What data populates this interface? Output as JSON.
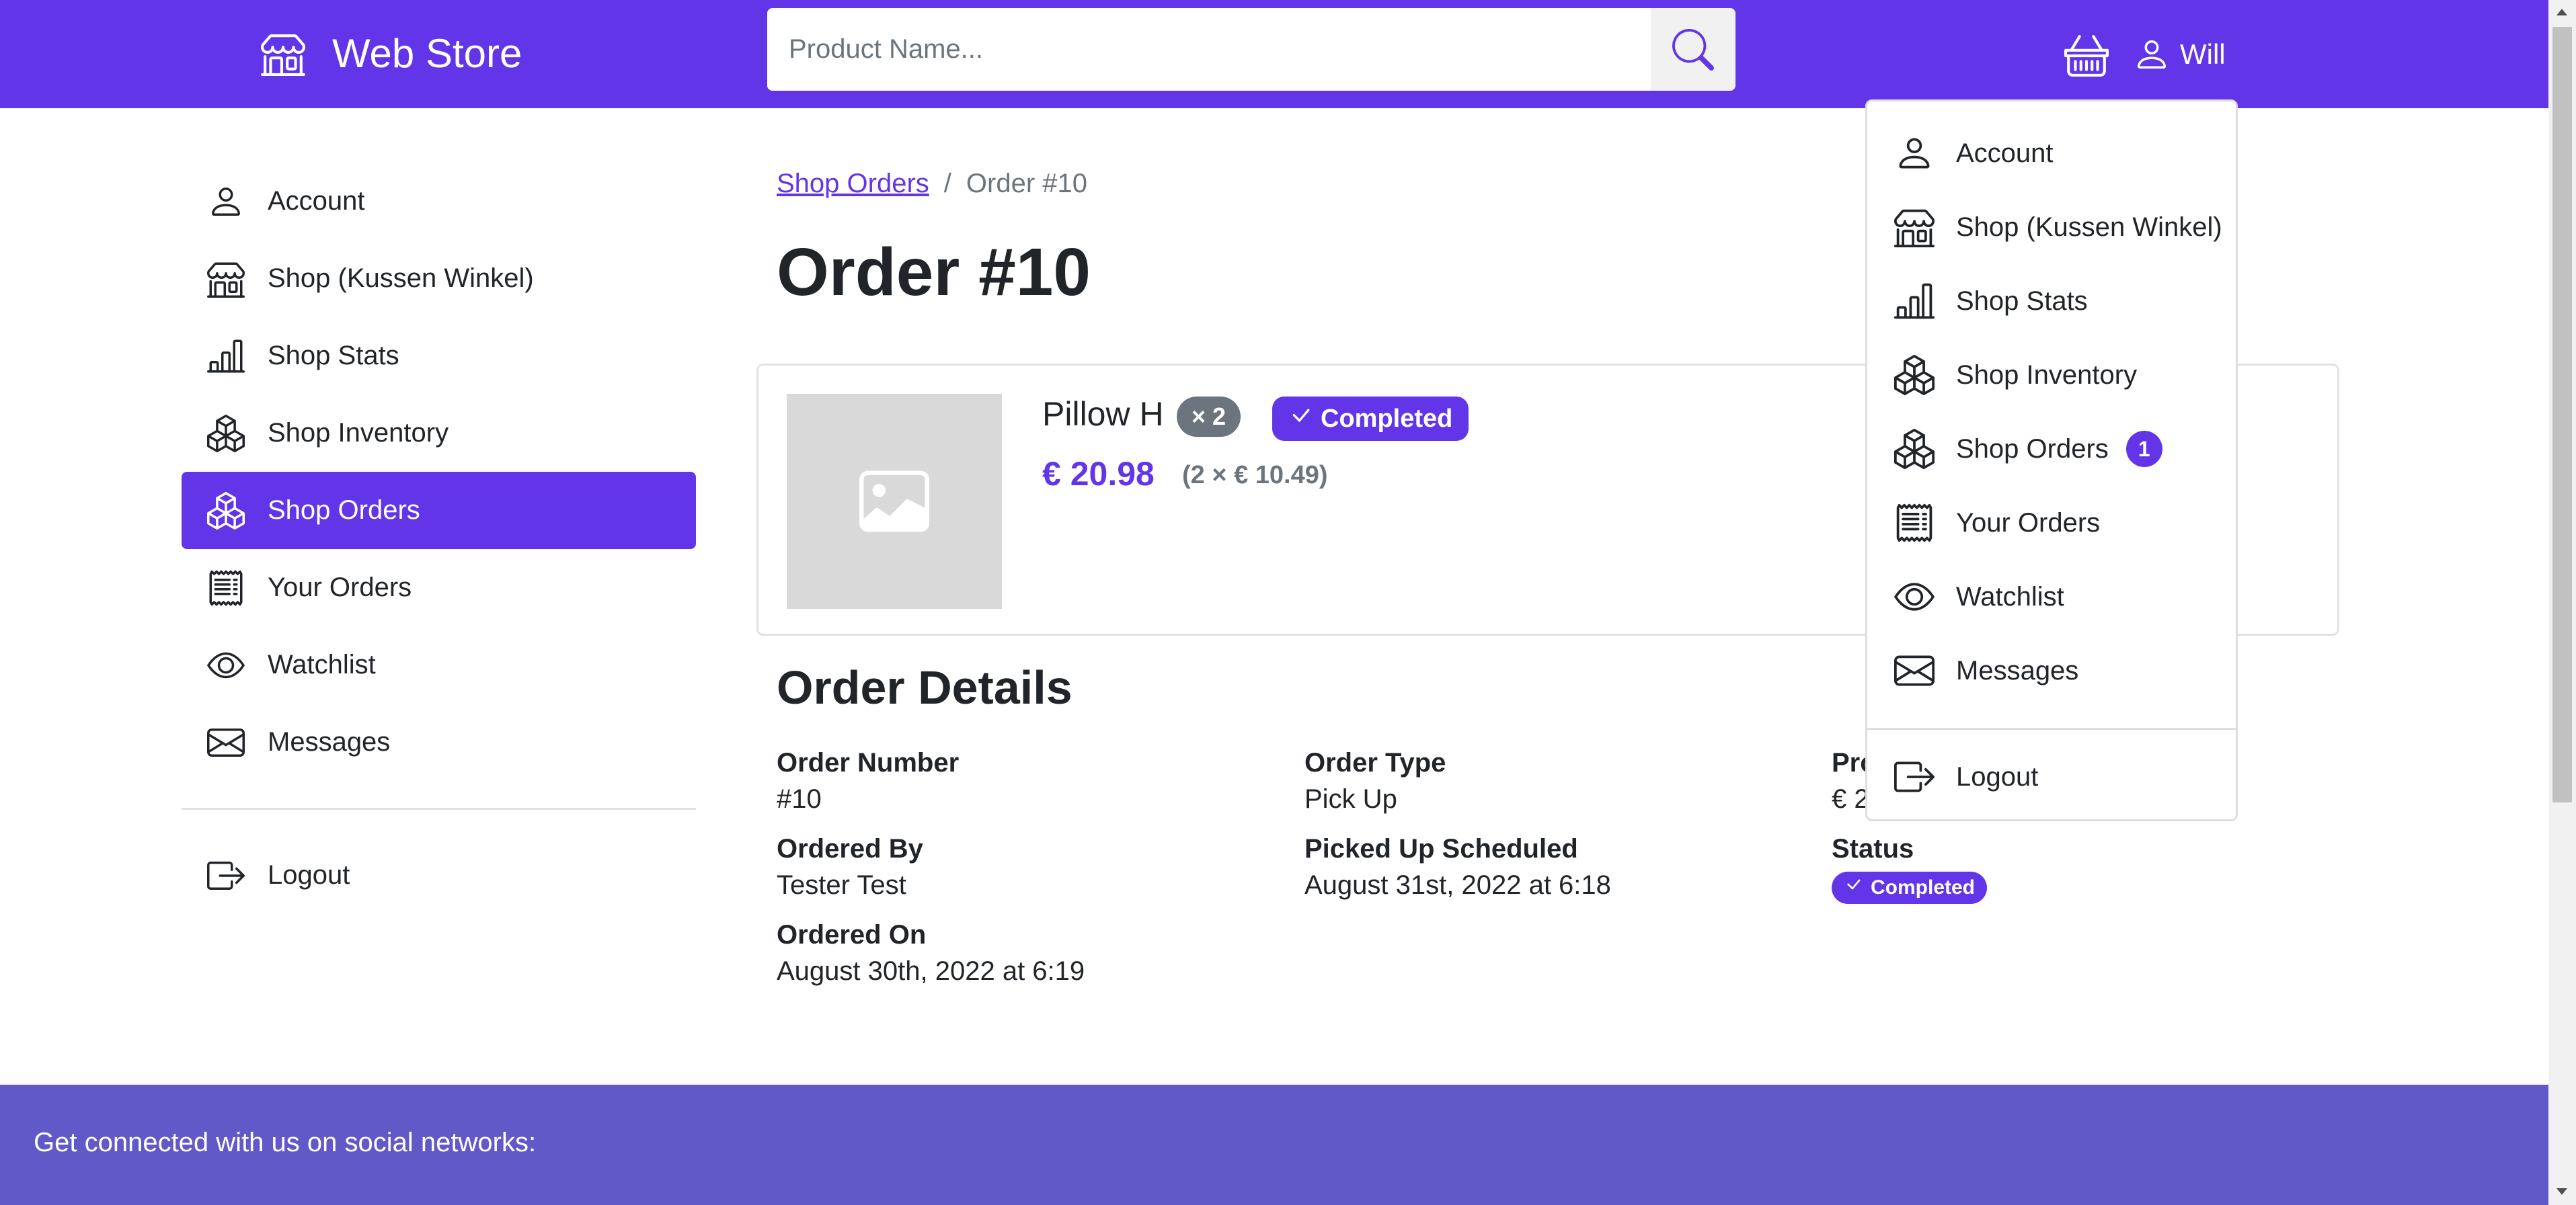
{
  "navbar": {
    "brand": "Web Store",
    "search_placeholder": "Product Name...",
    "user_name": "Will"
  },
  "sidebar": {
    "items": [
      {
        "label": "Account",
        "icon": "person-icon"
      },
      {
        "label": "Shop (Kussen Winkel)",
        "icon": "shop-icon"
      },
      {
        "label": "Shop Stats",
        "icon": "bar-chart-icon"
      },
      {
        "label": "Shop Inventory",
        "icon": "boxes-icon"
      },
      {
        "label": "Shop Orders",
        "icon": "boxes-icon",
        "active": true
      },
      {
        "label": "Your Orders",
        "icon": "receipt-icon"
      },
      {
        "label": "Watchlist",
        "icon": "eye-icon"
      },
      {
        "label": "Messages",
        "icon": "envelope-icon"
      }
    ],
    "logout": "Logout"
  },
  "breadcrumb": {
    "parent": "Shop Orders",
    "separator": "/",
    "current": "Order #10"
  },
  "page_title": "Order #10",
  "product": {
    "name": "Pillow H",
    "quantity": "× 2",
    "status": "Completed",
    "total": "€ 20.98",
    "unit": "(2 × € 10.49)"
  },
  "details": {
    "title": "Order Details",
    "order_number_label": "Order Number",
    "order_number": "#10",
    "ordered_by_label": "Ordered By",
    "ordered_by": "Tester Test",
    "ordered_on_label": "Ordered On",
    "ordered_on": "August 30th, 2022 at 6:19",
    "order_type_label": "Order Type",
    "order_type": "Pick Up",
    "picked_up_label": "Picked Up Scheduled",
    "picked_up": "August 31st, 2022 at 6:18",
    "price_label_partial": "Pro",
    "price_partial": "€ 2",
    "status_label": "Status",
    "status": "Completed"
  },
  "dropdown": {
    "items": [
      {
        "label": "Account",
        "icon": "person-icon"
      },
      {
        "label": "Shop (Kussen Winkel)",
        "icon": "shop-icon"
      },
      {
        "label": "Shop Stats",
        "icon": "bar-chart-icon"
      },
      {
        "label": "Shop Inventory",
        "icon": "boxes-icon"
      },
      {
        "label": "Shop Orders",
        "icon": "boxes-icon",
        "badge": "1"
      },
      {
        "label": "Your Orders",
        "icon": "receipt-icon"
      },
      {
        "label": "Watchlist",
        "icon": "eye-icon"
      },
      {
        "label": "Messages",
        "icon": "envelope-icon"
      }
    ],
    "logout": "Logout"
  },
  "footer": {
    "text": "Get connected with us on social networks:"
  },
  "colors": {
    "primary": "#6236e8",
    "footer": "#6159c8",
    "secondary_badge": "#6c757d",
    "placeholder_image": "#d9d9d9"
  }
}
